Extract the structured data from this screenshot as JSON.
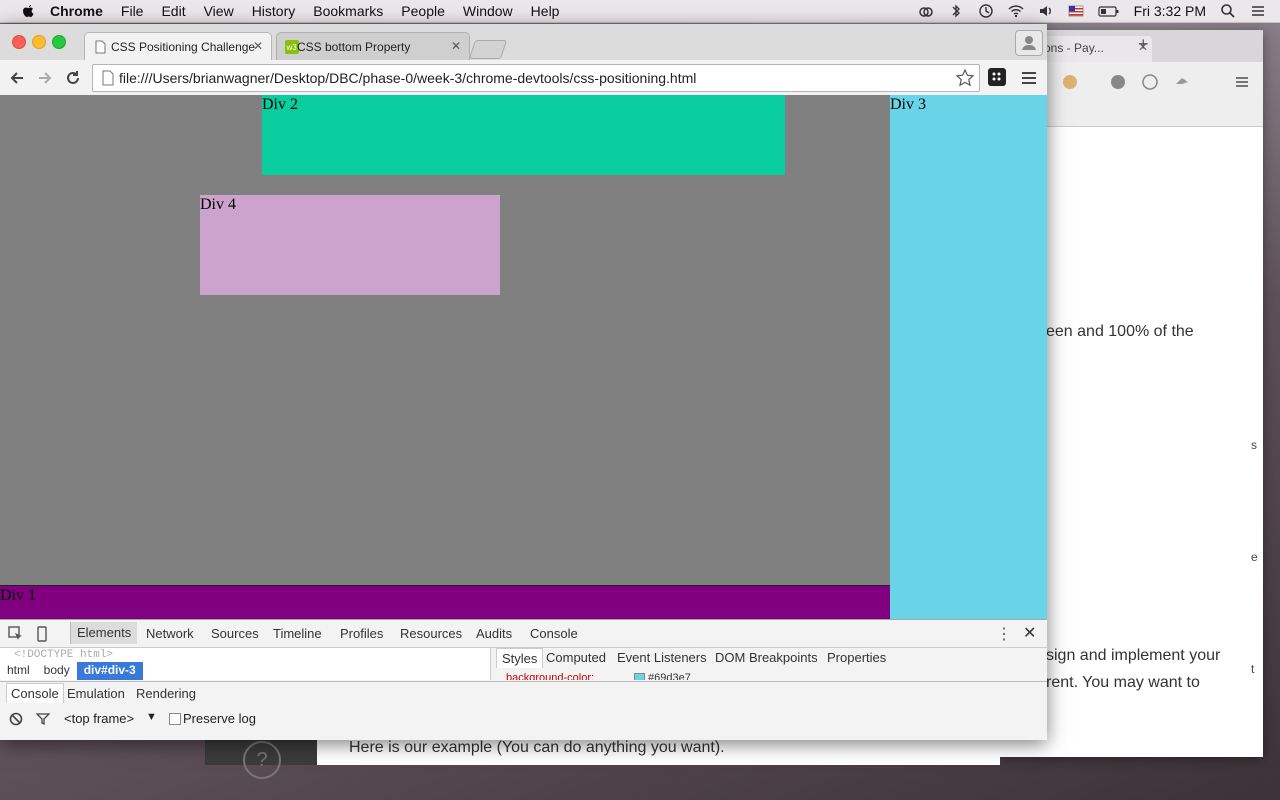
{
  "menubar": {
    "app": "Chrome",
    "items": [
      "File",
      "Edit",
      "View",
      "History",
      "Bookmarks",
      "People",
      "Window",
      "Help"
    ],
    "clock": "Fri 3:32 PM",
    "status_icons": [
      "creative-cloud-icon",
      "bluetooth-icon",
      "time-machine-icon",
      "wifi-icon",
      "volume-icon",
      "flag-icon",
      "battery-icon",
      "search-icon",
      "list-icon"
    ]
  },
  "browser": {
    "tabs": [
      {
        "label": "CSS Positioning Challenge",
        "active": true
      },
      {
        "label": "CSS bottom Property",
        "active": false
      }
    ],
    "url": "file:///Users/brianwagner/Desktop/DBC/phase-0/week-3/chrome-devtools/css-positioning.html"
  },
  "page": {
    "div1": "Div 1",
    "div2": "Div 2",
    "div3": "Div 3",
    "div4": "Div 4",
    "colors": {
      "background": "#808080",
      "div1": "#800080",
      "div2": "#09cc9f",
      "div3": "#69d3e7",
      "div4": "#cca3cc"
    }
  },
  "devtools": {
    "tabs": [
      "Elements",
      "Network",
      "Sources",
      "Timeline",
      "Profiles",
      "Resources",
      "Audits",
      "Console"
    ],
    "doctype": "<!DOCTYPE html>",
    "breadcrumbs": [
      "html",
      "body",
      "div#div-3"
    ],
    "side_tabs": [
      "Styles",
      "Computed",
      "Event Listeners",
      "DOM Breakpoints",
      "Properties"
    ],
    "style_row": {
      "property": "background-color:",
      "value": "#69d3e7"
    },
    "drawer_tabs": [
      "Console",
      "Emulation",
      "Rendering"
    ],
    "frame": "<top frame>",
    "preserve_log": "Preserve log"
  },
  "background_window": {
    "tab_label": "ons - Pay...",
    "text1": "een and 100% of the",
    "text2": "sign and implement your",
    "text3": "rent. You may want to",
    "edge_letters": [
      "s",
      "e",
      "t"
    ]
  },
  "behind_page": {
    "help": "?",
    "example": "Here is our example (You can do anything you want)."
  }
}
